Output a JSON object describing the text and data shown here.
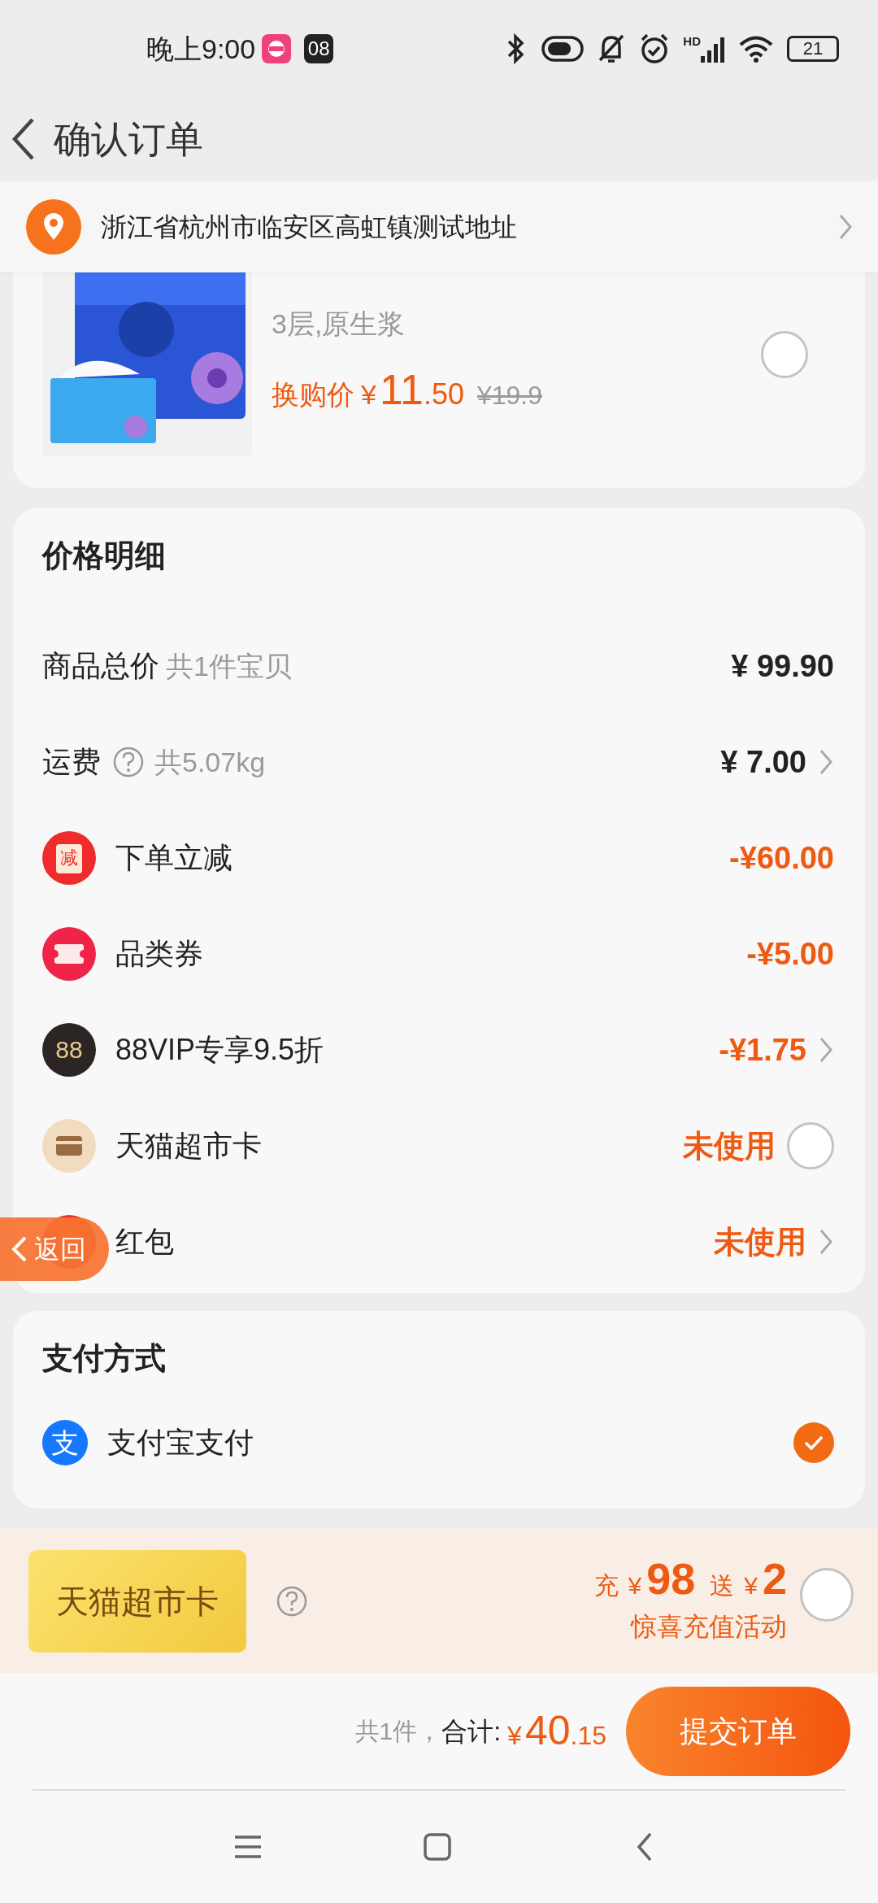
{
  "status_bar": {
    "time": "晚上9:00",
    "notification": "08",
    "signal_label": "HD",
    "battery": "21"
  },
  "header": {
    "title": "确认订单"
  },
  "address": {
    "text": "浙江省杭州市临安区高虹镇测试地址"
  },
  "product": {
    "spec": "3层,原生浆",
    "price_label": "换购价",
    "currency": "¥",
    "price_int": "11",
    "price_dec": ".50",
    "original_price": "¥19.9",
    "selected": false
  },
  "price_details": {
    "title": "价格明细",
    "rows": [
      {
        "kind": "total",
        "label": "商品总价",
        "note": "共1件宝贝",
        "amount": "¥ 99.90",
        "highlight": false
      },
      {
        "kind": "shipping",
        "label": "运费",
        "note": "共5.07kg",
        "amount": "¥ 7.00",
        "highlight": false,
        "chevron": true
      },
      {
        "kind": "cutback",
        "badge": "减",
        "label": "下单立减",
        "amount": "-¥60.00",
        "highlight": true
      },
      {
        "kind": "coupon",
        "label": "品类券",
        "amount": "-¥5.00",
        "highlight": true
      },
      {
        "kind": "vip",
        "badge": "88",
        "label": "88VIP专享9.5折",
        "amount": "-¥1.75",
        "highlight": true,
        "chevron": true
      },
      {
        "kind": "card",
        "label": "天猫超市卡",
        "amount": "未使用",
        "highlight": true,
        "checked": false
      },
      {
        "kind": "packet",
        "label": "红包",
        "amount": "未使用",
        "highlight": true,
        "chevron": true
      }
    ]
  },
  "floating_back": {
    "label": "返回"
  },
  "payment": {
    "title": "支付方式",
    "methods": [
      {
        "logo": "支",
        "label": "支付宝支付",
        "selected": true
      }
    ]
  },
  "promo": {
    "badge": "天猫超市卡",
    "recharge_label": "充",
    "recharge_currency": "¥",
    "recharge_amount": "98",
    "bonus_label": "送",
    "bonus_currency": "¥",
    "bonus_amount": "2",
    "subtitle": "惊喜充值活动",
    "selected": false
  },
  "footer": {
    "count": "共1件，",
    "total_label": "合计:",
    "total_currency": "¥",
    "total_int": "40",
    "total_dec": ".15",
    "submit": "提交订单"
  }
}
